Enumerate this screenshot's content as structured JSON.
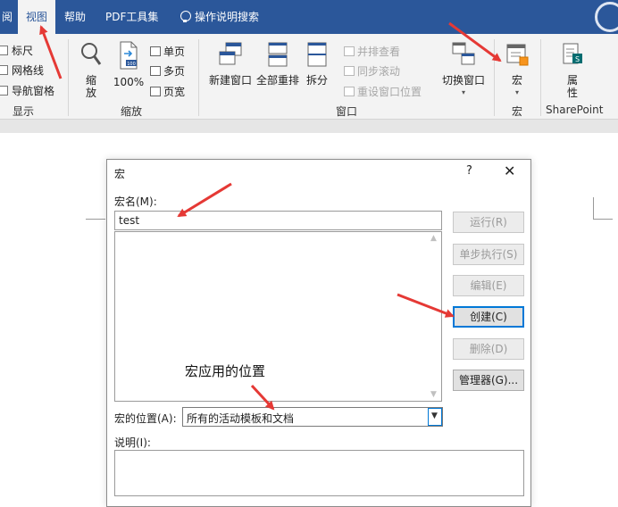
{
  "tabs": {
    "t0": "阅",
    "t1": "视图",
    "t2": "帮助",
    "t3": "PDF工具集",
    "t4": "操作说明搜索"
  },
  "ribbon": {
    "show": {
      "ruler": "标尺",
      "gridlines": "网格线",
      "nav_pane": "导航窗格",
      "label": "显示"
    },
    "zoom": {
      "zoom_l1": "缩",
      "zoom_l2": "放",
      "pct": "100%",
      "one_page": "单页",
      "multi_page": "多页",
      "page_width": "页宽",
      "label": "缩放"
    },
    "window": {
      "new_window": "新建窗口",
      "arrange_all": "全部重排",
      "split": "拆分",
      "side_by_side": "并排查看",
      "sync_scroll": "同步滚动",
      "reset_pos": "重设窗口位置",
      "switch_window": "切换窗口",
      "label": "窗口"
    },
    "macro": {
      "macros": "宏",
      "label": "宏"
    },
    "sharepoint": {
      "prop_l1": "属",
      "prop_l2": "性",
      "label": "SharePoint"
    }
  },
  "dialog": {
    "title": "宏",
    "help": "?",
    "close": "✕",
    "name_label": "宏名(M):",
    "name_value": "test",
    "buttons": {
      "run": "运行(R)",
      "step": "单步执行(S)",
      "edit": "编辑(E)",
      "create": "创建(C)",
      "delete": "删除(D)",
      "organizer": "管理器(G)..."
    },
    "location_label": "宏的位置(A):",
    "location_value": "所有的活动模板和文档",
    "desc_label": "说明(I):"
  },
  "annotation": "宏应用的位置",
  "colors": {
    "ribbon_blue": "#2b579a",
    "arrow_red": "#e53935",
    "default_button_border": "#0078d7"
  }
}
